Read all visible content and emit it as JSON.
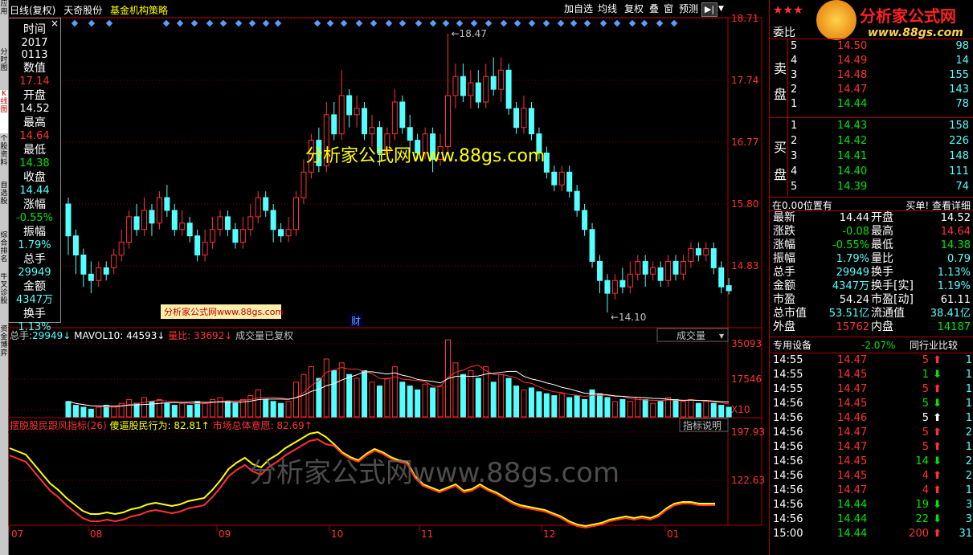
{
  "left_tabs": [
    "应用",
    "分时图",
    "K线图",
    "个股资料",
    "自选股",
    "综合排名",
    "牛叉诊股",
    "资金博弈"
  ],
  "title": {
    "period": "日线(复权)",
    "stock": "天奇股份",
    "indicator": "基金机构策略"
  },
  "toolbar": [
    "加自选",
    "均线",
    "复权",
    "叠",
    "窗",
    "预测"
  ],
  "info_box": [
    {
      "label": "时间",
      "value": "2017",
      "value2": "0113"
    },
    {
      "label": "数值",
      "value": "17.14"
    },
    {
      "label": "开盘",
      "value": "14.52"
    },
    {
      "label": "最高",
      "value": "14.64"
    },
    {
      "label": "最低",
      "value": "14.38"
    },
    {
      "label": "收盘",
      "value": "14.44"
    },
    {
      "label": "涨幅",
      "value": "-0.55%"
    },
    {
      "label": "振幅",
      "value": "1.79%"
    },
    {
      "label": "总手",
      "value": "29949"
    },
    {
      "label": "金额",
      "value": "4347万"
    },
    {
      "label": "换手",
      "value": "1.13%"
    }
  ],
  "price_axis": [
    "18.71",
    "17.74",
    "16.77",
    "15.80",
    "14.83"
  ],
  "high_label": "18.47",
  "low_label": "14.10",
  "watermark_main": "分析家公式网www.88gs.com",
  "watermark_small": "分析家公式网www.88gs.com",
  "watermark_bottom": "分析家公式网www.88gs.com",
  "cai_label": "财",
  "volume_header": {
    "total_label": "总手:",
    "total_value": "29949",
    "mavol_label": "MAVOL10:",
    "mavol_value": "44593",
    "ratio_label": "量比:",
    "ratio_value": "33692",
    "note": "成交量已复权",
    "dropdown": "成交量"
  },
  "volume_axis": [
    "35093",
    "17546",
    "X10"
  ],
  "indicator_header": {
    "name": "摆脱股民跟风指标(26)",
    "s1_label": "傻逼股民行为:",
    "s1_value": "82.81",
    "s2_label": "市场总体意愿:",
    "s2_value": "82.69",
    "help": "指标说明"
  },
  "indicator_axis": [
    "197.93",
    "122.63"
  ],
  "x_axis": [
    "07",
    "08",
    "09",
    "10",
    "11",
    "12",
    "01"
  ],
  "logo": {
    "text": "分析家公式网",
    "url": "www.88gs.com"
  },
  "order_book": {
    "title": "委比",
    "sell_label": [
      "卖",
      "盘"
    ],
    "buy_label": [
      "买",
      "盘"
    ],
    "sell": [
      {
        "level": "5",
        "price": "14.50",
        "vol": "98"
      },
      {
        "level": "4",
        "price": "14.49",
        "vol": "14"
      },
      {
        "level": "3",
        "price": "14.48",
        "vol": "155"
      },
      {
        "level": "2",
        "price": "14.47",
        "vol": "143"
      },
      {
        "level": "1",
        "price": "14.44",
        "vol": "78"
      }
    ],
    "buy": [
      {
        "level": "1",
        "price": "14.43",
        "vol": "158"
      },
      {
        "level": "2",
        "price": "14.42",
        "vol": "226"
      },
      {
        "level": "3",
        "price": "14.41",
        "vol": "148"
      },
      {
        "level": "4",
        "price": "14.40",
        "vol": "111"
      },
      {
        "level": "5",
        "price": "14.39",
        "vol": "74"
      }
    ],
    "position_note": "在0.00位置有",
    "detail_link": "买单! 查看详细"
  },
  "quote": [
    {
      "l1": "最新",
      "v1": "14.44",
      "l2": "开盘",
      "v2": "14.52"
    },
    {
      "l1": "涨跌",
      "v1": "-0.08",
      "l2": "最高",
      "v2": "14.64"
    },
    {
      "l1": "涨幅",
      "v1": "-0.55%",
      "l2": "最低",
      "v2": "14.38"
    },
    {
      "l1": "振幅",
      "v1": "1.79%",
      "l2": "量比",
      "v2": "0.79"
    },
    {
      "l1": "总手",
      "v1": "29949",
      "l2": "换手",
      "v2": "1.13%"
    },
    {
      "l1": "金额",
      "v1": "4347万",
      "l2": "换手[实]",
      "v2": "1.19%"
    },
    {
      "l1": "市盈",
      "v1": "54.24",
      "l2": "市盈[动]",
      "v2": "61.11"
    },
    {
      "l1": "总市值",
      "v1": "53.51亿",
      "l2": "流通值",
      "v2": "38.41亿"
    },
    {
      "l1": "外盘",
      "v1": "15762",
      "l2": "内盘",
      "v2": "14187"
    }
  ],
  "sector": {
    "name": "专用设备",
    "change": "-2.07%",
    "compare": "同行业比较"
  },
  "ticks": [
    {
      "time": "14:55",
      "price": "14.47",
      "vol": "5",
      "dir": "up",
      "n": "1"
    },
    {
      "time": "14:55",
      "price": "14.45",
      "vol": "1",
      "dir": "down",
      "n": "1"
    },
    {
      "time": "14:55",
      "price": "14.47",
      "vol": "5",
      "dir": "up",
      "n": "1"
    },
    {
      "time": "14:56",
      "price": "14.45",
      "vol": "5",
      "dir": "down",
      "n": "1"
    },
    {
      "time": "14:56",
      "price": "14.46",
      "vol": "5",
      "dir": "white",
      "n": "1"
    },
    {
      "time": "14:56",
      "price": "14.47",
      "vol": "5",
      "dir": "up",
      "n": "2"
    },
    {
      "time": "14:56",
      "price": "14.47",
      "vol": "5",
      "dir": "up",
      "n": "1"
    },
    {
      "time": "14:56",
      "price": "14.45",
      "vol": "14",
      "dir": "down",
      "n": "2"
    },
    {
      "time": "14:56",
      "price": "14.45",
      "vol": "4",
      "dir": "up",
      "n": "2"
    },
    {
      "time": "14:56",
      "price": "14.47",
      "vol": "4",
      "dir": "up",
      "n": "1"
    },
    {
      "time": "14:56",
      "price": "14.44",
      "vol": "19",
      "dir": "down",
      "n": "3"
    },
    {
      "time": "14:56",
      "price": "14.44",
      "vol": "22",
      "dir": "down",
      "n": "3"
    },
    {
      "time": "15:00",
      "price": "14.44",
      "vol": "200",
      "dir": "up",
      "n": "31"
    }
  ]
}
